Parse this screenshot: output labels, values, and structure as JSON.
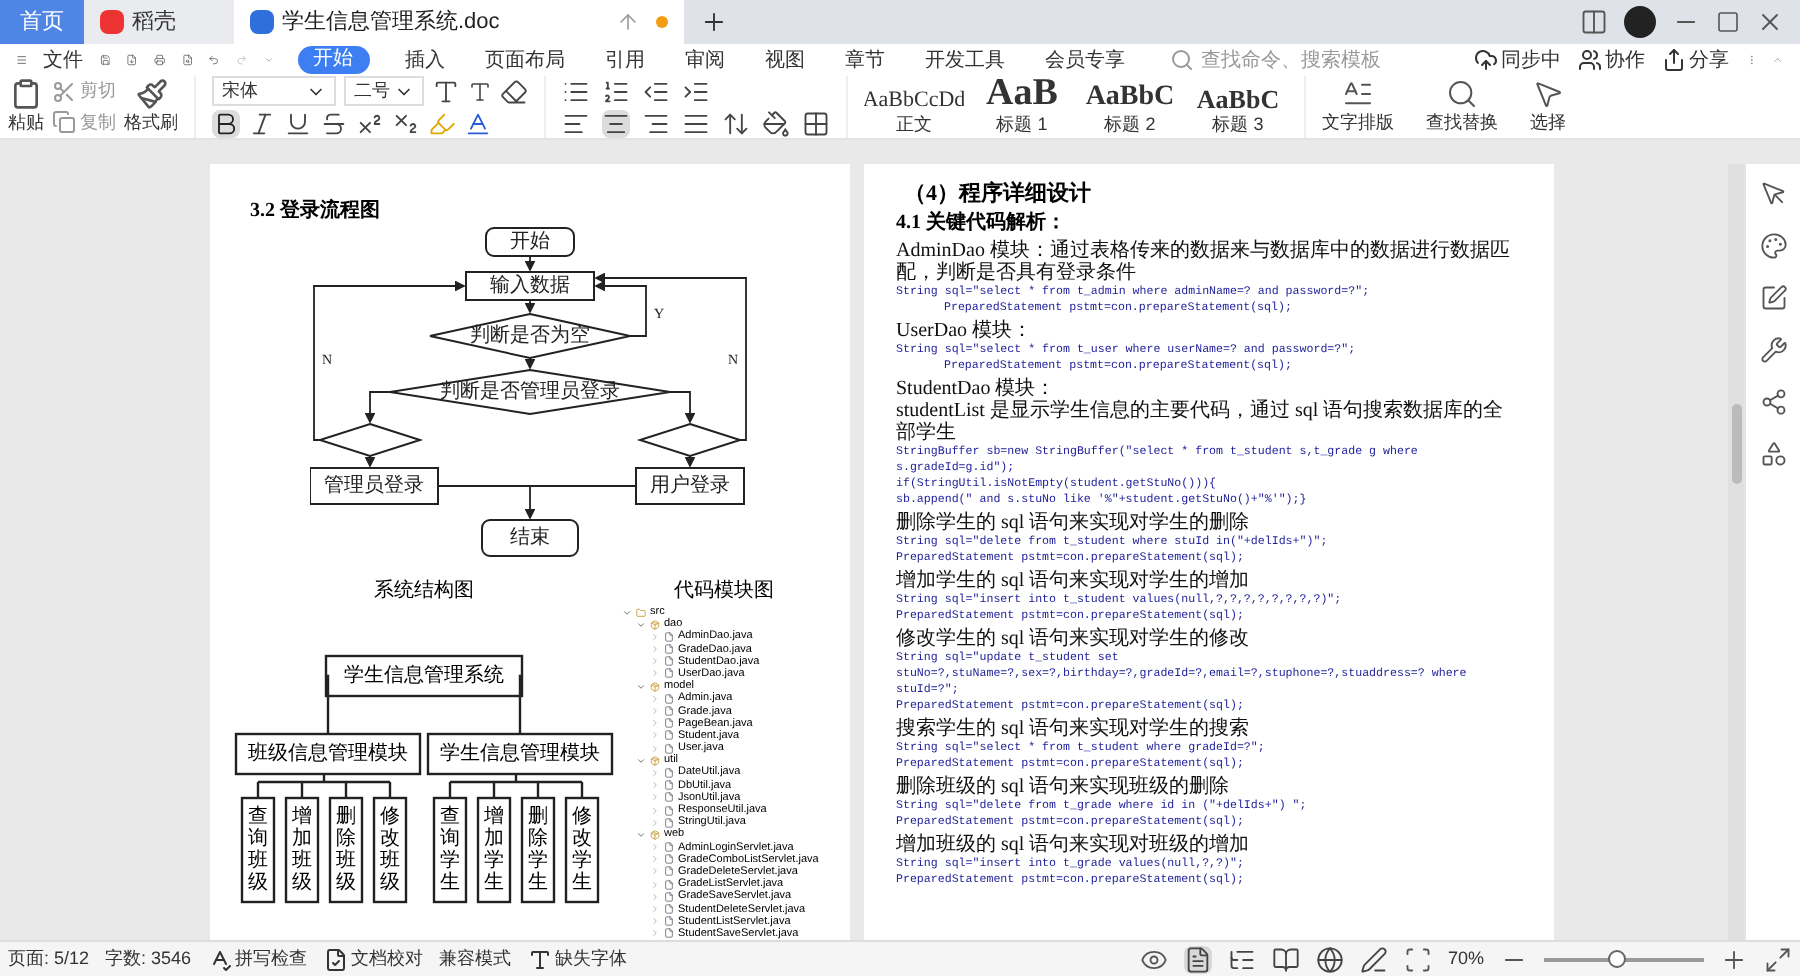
{
  "tabs": [
    {
      "kind": "home",
      "label": "首页",
      "selected": false
    },
    {
      "kind": "app",
      "label": "稻壳",
      "selected": false
    },
    {
      "kind": "doc",
      "label": "学生信息管理系统.doc",
      "selected": true,
      "unsaved": true
    }
  ],
  "menu": {
    "file": "文件",
    "items": [
      {
        "label": "开始",
        "selected": true
      },
      {
        "label": "插入",
        "selected": false
      },
      {
        "label": "页面布局",
        "selected": false
      },
      {
        "label": "引用",
        "selected": false
      },
      {
        "label": "审阅",
        "selected": false
      },
      {
        "label": "视图",
        "selected": false
      },
      {
        "label": "章节",
        "selected": false
      },
      {
        "label": "开发工具",
        "selected": false
      },
      {
        "label": "会员专享",
        "selected": false
      }
    ],
    "search": {
      "placeholder": "查找命令、搜索模板"
    },
    "actions": [
      "同步中",
      "协作",
      "分享"
    ]
  },
  "ribbon": {
    "paste": "粘贴",
    "cut": "剪切",
    "copy": "复制",
    "format_painter": "格式刷",
    "font_name": "宋体",
    "font_size": "二号",
    "bold": {
      "selected": true
    },
    "align": [
      {
        "kind": "left",
        "selected": false
      },
      {
        "kind": "center",
        "selected": true
      },
      {
        "kind": "right",
        "selected": false
      },
      {
        "kind": "justify",
        "selected": false
      }
    ],
    "styles": [
      {
        "kind": "body",
        "sample": "AaBbCcDd",
        "label": "正文"
      },
      {
        "kind": "h1",
        "sample": "AaB",
        "label": "标题 1"
      },
      {
        "kind": "h2",
        "sample": "AaBbC",
        "label": "标题 2"
      },
      {
        "kind": "h3",
        "sample": "AaBbC",
        "label": "标题 3"
      }
    ],
    "tools": [
      {
        "kind": "layout",
        "label": "文字排版"
      },
      {
        "kind": "find",
        "label": "查找替换"
      },
      {
        "kind": "select",
        "label": "选择"
      }
    ]
  },
  "left_page": {
    "heading": "3.2 登录流程图",
    "flowchart": {
      "start": "开始",
      "input": "输入数据",
      "check_empty": "判断是否为空",
      "check_admin": "判断是否管理员登录",
      "admin_login": "管理员登录",
      "user_login": "用户登录",
      "end": "结束",
      "no_left": "N",
      "no_right": "N",
      "yes": "Y"
    },
    "structure_title": "系统结构图",
    "structure": {
      "root": "学生信息管理系统",
      "modules": [
        {
          "label": "班级信息管理模块",
          "children": [
            "查询班级",
            "增加班级",
            "删除班级",
            "修改班级"
          ]
        },
        {
          "label": "学生信息管理模块",
          "children": [
            "查询学生",
            "增加学生",
            "删除学生",
            "修改学生"
          ]
        }
      ]
    },
    "tree_title": "代码模块图",
    "tree": [
      {
        "label": "src",
        "kind": "folder",
        "children": [
          {
            "label": "dao",
            "kind": "package",
            "children": [
              {
                "label": "AdminDao.java",
                "kind": "file"
              },
              {
                "label": "GradeDao.java",
                "kind": "file"
              },
              {
                "label": "StudentDao.java",
                "kind": "file"
              },
              {
                "label": "UserDao.java",
                "kind": "file"
              }
            ]
          },
          {
            "label": "model",
            "kind": "package",
            "children": [
              {
                "label": "Admin.java",
                "kind": "file"
              },
              {
                "label": "Grade.java",
                "kind": "file"
              },
              {
                "label": "PageBean.java",
                "kind": "file"
              },
              {
                "label": "Student.java",
                "kind": "file"
              },
              {
                "label": "User.java",
                "kind": "file"
              }
            ]
          },
          {
            "label": "util",
            "kind": "package",
            "children": [
              {
                "label": "DateUtil.java",
                "kind": "file"
              },
              {
                "label": "DbUtil.java",
                "kind": "file"
              },
              {
                "label": "JsonUtil.java",
                "kind": "file"
              },
              {
                "label": "ResponseUtil.java",
                "kind": "file"
              },
              {
                "label": "StringUtil.java",
                "kind": "file"
              }
            ]
          },
          {
            "label": "web",
            "kind": "package",
            "children": [
              {
                "label": "AdminLoginServlet.java",
                "kind": "file"
              },
              {
                "label": "GradeComboListServlet.java",
                "kind": "file"
              },
              {
                "label": "GradeDeleteServlet.java",
                "kind": "file"
              },
              {
                "label": "GradeListServlet.java",
                "kind": "file"
              },
              {
                "label": "GradeSaveServlet.java",
                "kind": "file"
              },
              {
                "label": "StudentDeleteServlet.java",
                "kind": "file"
              },
              {
                "label": "StudentListServlet.java",
                "kind": "file"
              },
              {
                "label": "StudentSaveServlet.java",
                "kind": "file"
              }
            ]
          }
        ]
      }
    ]
  },
  "right_page": {
    "title": "（4）程序详细设计",
    "heading": "4.1 关键代码解析：",
    "blocks": [
      [
        {
          "kind": "text",
          "text": "AdminDao 模块：通过表格传来的数据来与数据库中的数据进行数据匹配，判断是否具有登录条件"
        },
        {
          "kind": "code",
          "text": "String sql=\"select * from t_admin where adminName=? and password=?\";"
        },
        {
          "kind": "code_indent",
          "text": "PreparedStatement pstmt=con.prepareStatement(sql);"
        }
      ],
      [
        {
          "kind": "text",
          "text": "UserDao 模块："
        },
        {
          "kind": "code",
          "text": "String sql=\"select * from t_user where userName=? and password=?\";"
        },
        {
          "kind": "code_indent",
          "text": "PreparedStatement pstmt=con.prepareStatement(sql);"
        }
      ],
      [
        {
          "kind": "text",
          "text": "StudentDao 模块："
        },
        {
          "kind": "text",
          "text": "studentList 是显示学生信息的主要代码，通过 sql 语句搜索数据库的全部学生"
        },
        {
          "kind": "code",
          "text": "StringBuffer sb=new StringBuffer(\"select * from t_student s,t_grade g where s.gradeId=g.id\");"
        },
        {
          "kind": "code",
          "text": "if(StringUtil.isNotEmpty(student.getStuNo())){"
        },
        {
          "kind": "code",
          "text": "sb.append(\" and s.stuNo like '%\"+student.getStuNo()+\"%'\");}"
        }
      ],
      [
        {
          "kind": "text",
          "text": "删除学生的 sql 语句来实现对学生的删除"
        },
        {
          "kind": "code",
          "text": "String sql=\"delete from t_student where stuId in(\"+delIds+\")\";"
        },
        {
          "kind": "code",
          "text": "PreparedStatement pstmt=con.prepareStatement(sql);"
        }
      ],
      [
        {
          "kind": "text",
          "text": "增加学生的 sql 语句来实现对学生的增加"
        },
        {
          "kind": "code",
          "text": "String sql=\"insert into t_student values(null,?,?,?,?,?,?,?,?)\";"
        },
        {
          "kind": "code",
          "text": "PreparedStatement pstmt=con.prepareStatement(sql);"
        }
      ],
      [
        {
          "kind": "text",
          "text": "修改学生的 sql 语句来实现对学生的修改"
        },
        {
          "kind": "code",
          "text": "String sql=\"update t_student set stuNo=?,stuName=?,sex=?,birthday=?,gradeId=?,email=?,stuphone=?,stuaddress=? where stuId=?\";"
        },
        {
          "kind": "code",
          "text": "PreparedStatement pstmt=con.prepareStatement(sql);"
        }
      ],
      [
        {
          "kind": "text",
          "text": "搜索学生的 sql 语句来实现对学生的搜索"
        },
        {
          "kind": "code",
          "text": "String sql=\"select * from t_student where gradeId=?\";"
        },
        {
          "kind": "code",
          "text": "PreparedStatement pstmt=con.prepareStatement(sql);"
        }
      ],
      [
        {
          "kind": "text",
          "text": "删除班级的 sql 语句来实现班级的删除"
        },
        {
          "kind": "code",
          "text": "String sql=\"delete from t_grade where id in (\"+delIds+\") \";"
        },
        {
          "kind": "code",
          "text": "PreparedStatement pstmt=con.prepareStatement(sql);"
        }
      ],
      [
        {
          "kind": "text",
          "text": "增加班级的 sql 语句来实现对班级的增加"
        },
        {
          "kind": "code",
          "text": "String sql=\"insert into t_grade values(null,?,?)\";"
        },
        {
          "kind": "code",
          "text": "PreparedStatement pstmt=con.prepareStatement(sql);"
        }
      ]
    ]
  },
  "status_bar": {
    "page": "页面: 5/12",
    "words": "字数: 3546",
    "spell_check": "拼写检查",
    "proofread": "文档校对",
    "compat_mode": "兼容模式",
    "missing_font": "缺失字体",
    "zoom": "70%",
    "zoom_slider": {
      "level": 0.45
    },
    "views": [
      {
        "kind": "page",
        "selected": true
      },
      {
        "kind": "outline",
        "selected": false
      },
      {
        "kind": "read",
        "selected": false
      },
      {
        "kind": "web",
        "selected": false
      },
      {
        "kind": "write",
        "selected": false
      }
    ]
  }
}
